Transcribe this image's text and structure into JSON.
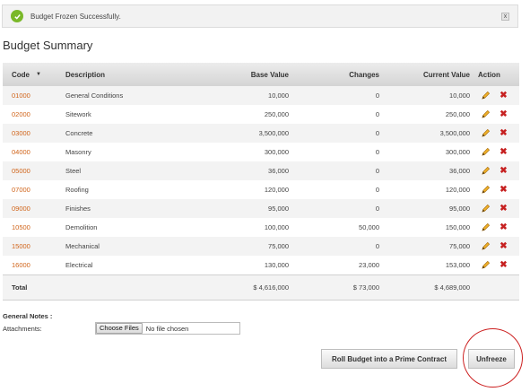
{
  "alert": {
    "message": "Budget Frozen Successfully.",
    "close_label": "x"
  },
  "page_title": "Budget Summary",
  "table": {
    "headers": {
      "code": "Code",
      "description": "Description",
      "base_value": "Base Value",
      "changes": "Changes",
      "current_value": "Current Value",
      "action": "Action"
    },
    "rows": [
      {
        "code": "01000",
        "description": "General Conditions",
        "base_value": "10,000",
        "changes": "0",
        "current_value": "10,000"
      },
      {
        "code": "02000",
        "description": "Sitework",
        "base_value": "250,000",
        "changes": "0",
        "current_value": "250,000"
      },
      {
        "code": "03000",
        "description": "Concrete",
        "base_value": "3,500,000",
        "changes": "0",
        "current_value": "3,500,000"
      },
      {
        "code": "04000",
        "description": "Masonry",
        "base_value": "300,000",
        "changes": "0",
        "current_value": "300,000"
      },
      {
        "code": "05000",
        "description": "Steel",
        "base_value": "36,000",
        "changes": "0",
        "current_value": "36,000"
      },
      {
        "code": "07000",
        "description": "Roofing",
        "base_value": "120,000",
        "changes": "0",
        "current_value": "120,000"
      },
      {
        "code": "09000",
        "description": "Finishes",
        "base_value": "95,000",
        "changes": "0",
        "current_value": "95,000"
      },
      {
        "code": "10500",
        "description": "Demolition",
        "base_value": "100,000",
        "changes": "50,000",
        "current_value": "150,000"
      },
      {
        "code": "15000",
        "description": "Mechanical",
        "base_value": "75,000",
        "changes": "0",
        "current_value": "75,000"
      },
      {
        "code": "16000",
        "description": "Electrical",
        "base_value": "130,000",
        "changes": "23,000",
        "current_value": "153,000"
      }
    ],
    "total": {
      "label": "Total",
      "base_value": "$ 4,616,000",
      "changes": "$ 73,000",
      "current_value": "$ 4,689,000"
    }
  },
  "notes": {
    "label": "General Notes :",
    "attachments_label": "Attachments:",
    "choose_files": "Choose Files",
    "file_status": "No file chosen"
  },
  "buttons": {
    "roll": "Roll Budget into a Prime Contract",
    "unfreeze": "Unfreeze"
  },
  "colors": {
    "code_link": "#d0641a",
    "success": "#7ab829",
    "delete": "#c62020",
    "highlight_circle": "#cc2020"
  },
  "icons": {
    "alert": "check-circle-icon",
    "close": "close-icon",
    "sort": "sort-down-icon",
    "edit": "pencil-icon",
    "delete": "delete-x-icon"
  }
}
